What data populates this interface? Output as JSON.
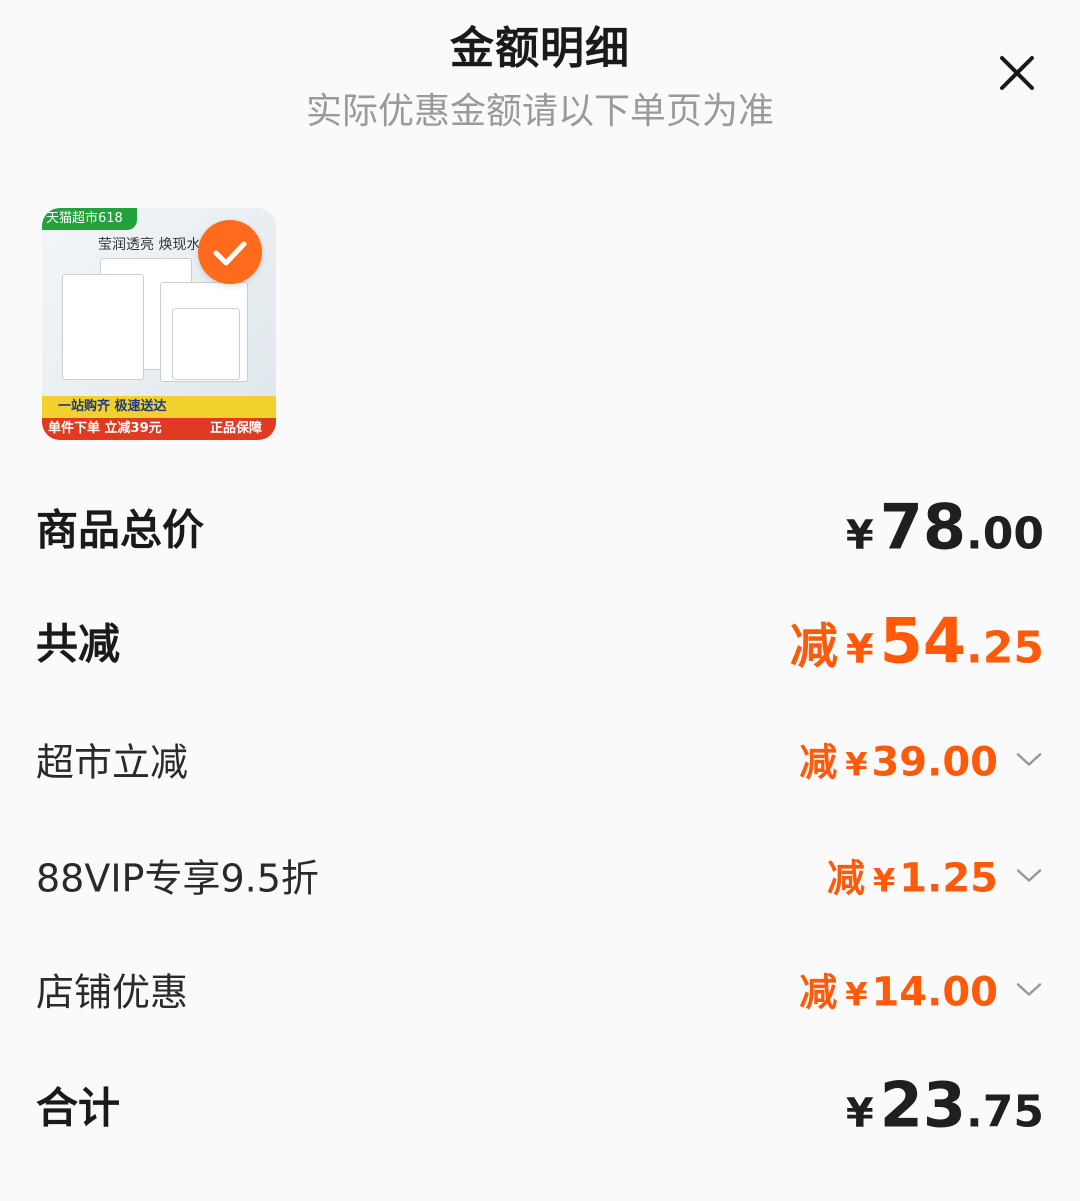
{
  "header": {
    "title": "金额明细",
    "subtitle": "实际优惠金额请以下单页为准"
  },
  "product": {
    "tag": "天猫超市618",
    "headline": "莹润透亮 焕现水",
    "bar1": "一站购齐 极速送达",
    "bar2_left": "单件下单 立减39元",
    "bar2_right": "正品保障",
    "selected": true,
    "accent": "#ff6a1c"
  },
  "summary": {
    "subtotal": {
      "label": "商品总价",
      "currency": "¥",
      "int": "78",
      "dec": ".00"
    },
    "total_discount": {
      "label": "共减",
      "minus": "减",
      "currency": "¥",
      "int": "54",
      "dec": ".25"
    },
    "discounts": [
      {
        "label": "超市立减",
        "minus": "减",
        "currency": "¥",
        "amount": "39.00"
      },
      {
        "label": "88VIP专享9.5折",
        "minus": "减",
        "currency": "¥",
        "amount": "1.25"
      },
      {
        "label": "店铺优惠",
        "minus": "减",
        "currency": "¥",
        "amount": "14.00"
      }
    ],
    "total": {
      "label": "合计",
      "currency": "¥",
      "int": "23",
      "dec": ".75"
    }
  },
  "colors": {
    "accent_orange": "#ff5a0a",
    "text_dark": "#1f1f1f",
    "subtitle_gray": "#9a9a9a",
    "background": "#fafafa"
  },
  "icons": {
    "close": "close-icon",
    "check": "check-icon",
    "expand": "chevron-down-icon"
  }
}
